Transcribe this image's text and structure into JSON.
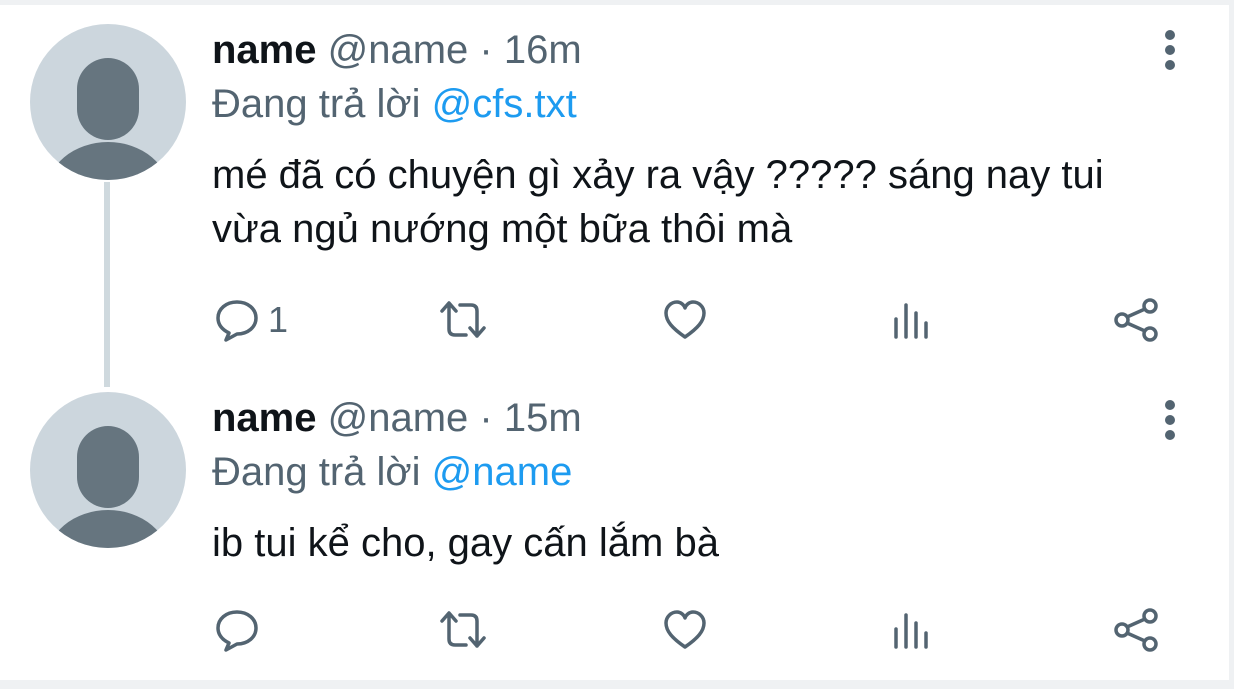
{
  "tweets": [
    {
      "name": "name",
      "handle": "@name",
      "separator": "·",
      "time": "16m",
      "reply_prefix": "Đang trả lời",
      "reply_to": "@cfs.txt",
      "text": "mé đã có chuyện gì xảy ra vậy ????? sáng nay tui vừa ngủ nướng một bữa thôi mà",
      "reply_count": "1"
    },
    {
      "name": "name",
      "handle": "@name",
      "separator": "·",
      "time": "15m",
      "reply_prefix": "Đang trả lời",
      "reply_to": "@name",
      "text": "ib tui kể cho, gay cấn lắm bà",
      "reply_count": ""
    }
  ],
  "icons": {
    "reply": "reply-icon",
    "retweet": "retweet-icon",
    "like": "like-icon",
    "analytics": "analytics-icon",
    "share": "share-icon",
    "more": "more-vertical-icon",
    "avatar": "default-avatar-icon"
  },
  "colors": {
    "text": "#0f1419",
    "secondary": "#536471",
    "mention": "#1d9bf0",
    "avatar_bg": "#ccd6dd",
    "avatar_fg": "#66757f",
    "thread_line": "#cfd9de"
  }
}
